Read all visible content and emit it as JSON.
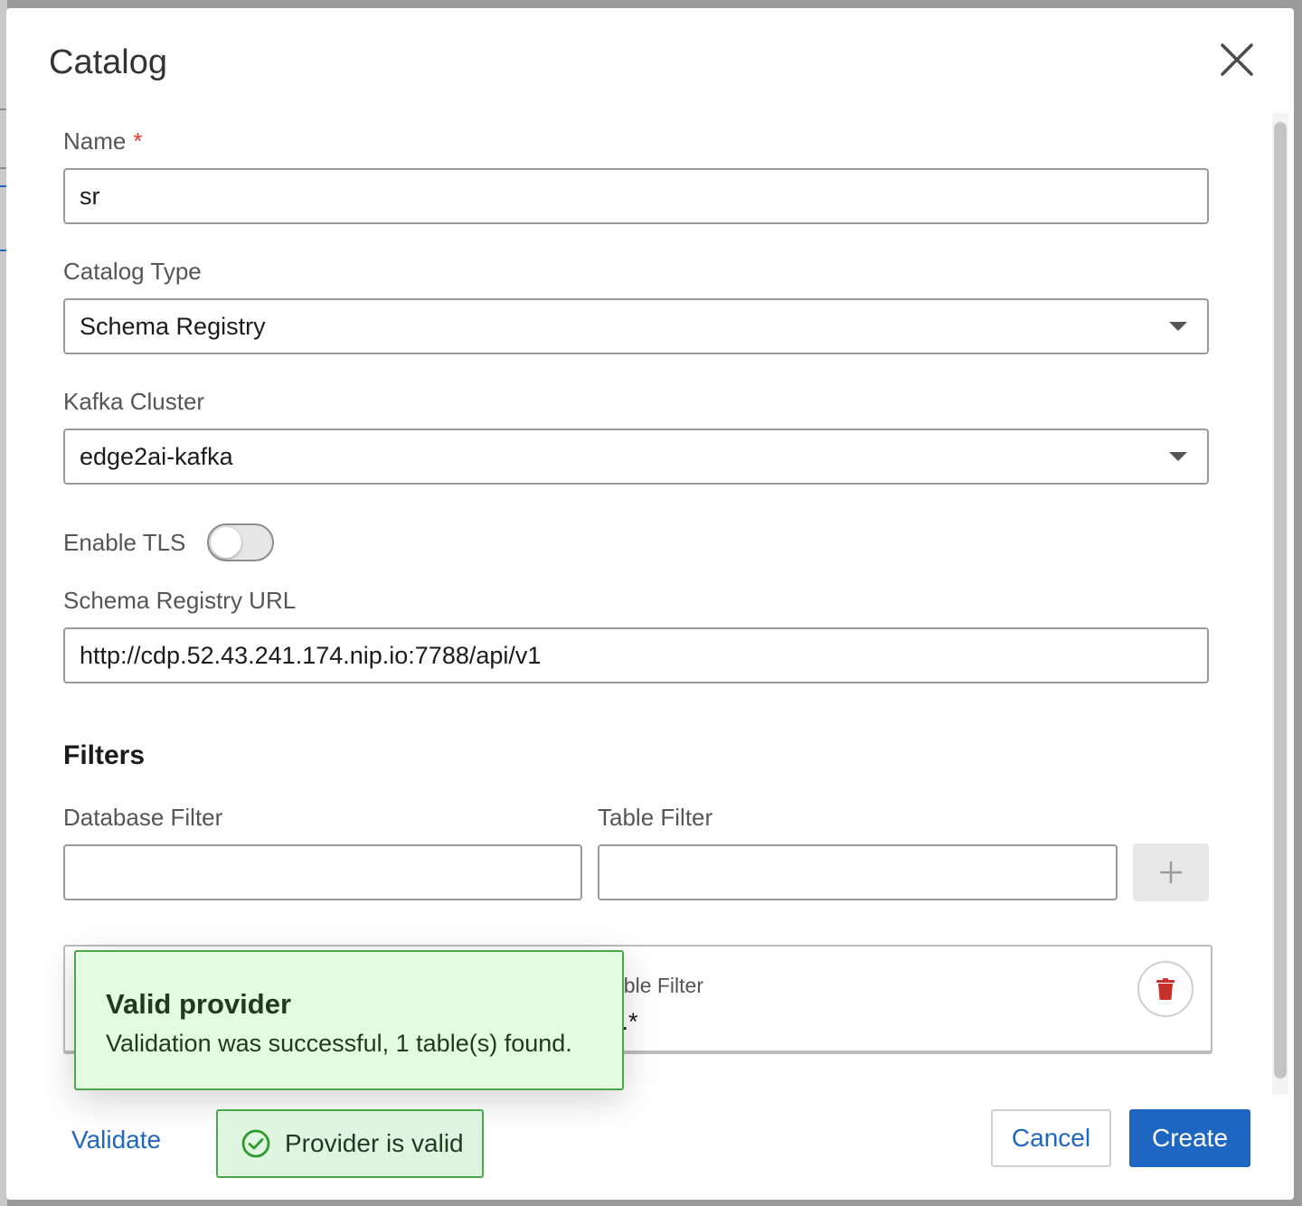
{
  "dialog": {
    "title": "Catalog"
  },
  "form": {
    "name": {
      "label": "Name",
      "required_marker": "*",
      "value": "sr"
    },
    "catalog_type": {
      "label": "Catalog Type",
      "value": "Schema Registry"
    },
    "kafka_cluster": {
      "label": "Kafka Cluster",
      "value": "edge2ai-kafka"
    },
    "enable_tls": {
      "label": "Enable TLS",
      "enabled": false
    },
    "schema_registry_url": {
      "label": "Schema Registry URL",
      "value": "http://cdp.52.43.241.174.nip.io:7788/api/v1"
    }
  },
  "filters": {
    "title": "Filters",
    "database_filter": {
      "label": "Database Filter",
      "value": ""
    },
    "table_filter": {
      "label": "Table Filter",
      "value": ""
    },
    "add_icon": "plus-icon",
    "existing": {
      "table_filter_label_partial": "able Filter",
      "table_filter_value_partial": "t.*",
      "delete_icon": "trash-icon"
    }
  },
  "toast": {
    "title": "Valid provider",
    "message": "Validation was successful, 1 table(s) found."
  },
  "footer": {
    "validate_label": "Validate",
    "status_text": "Provider is valid",
    "status_icon": "check-circle-icon",
    "cancel_label": "Cancel",
    "create_label": "Create"
  },
  "colors": {
    "primary": "#1f66c2",
    "success_border": "#4aa84a",
    "success_bg": "#e2fbe2",
    "required": "#e03c31",
    "danger": "#c9302c"
  }
}
